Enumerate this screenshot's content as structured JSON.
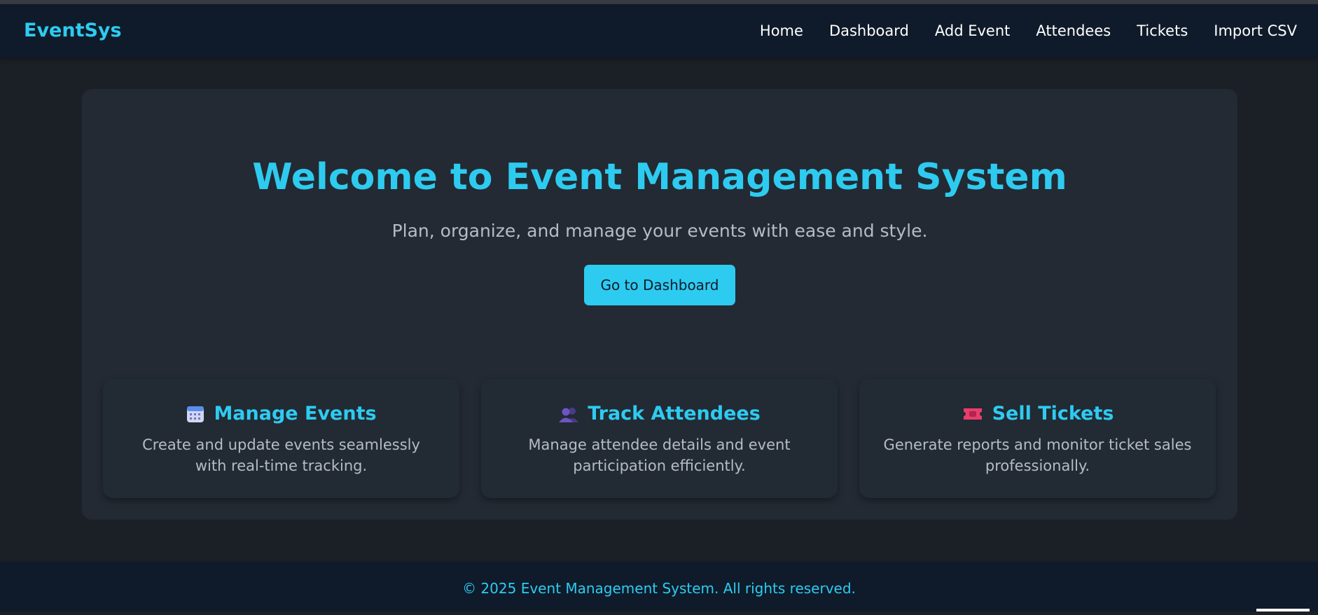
{
  "brand": "EventSys",
  "nav": {
    "items": [
      "Home",
      "Dashboard",
      "Add Event",
      "Attendees",
      "Tickets",
      "Import CSV"
    ]
  },
  "hero": {
    "title": "Welcome to Event Management System",
    "subtitle": "Plan, organize, and manage your events with ease and style.",
    "cta_label": "Go to Dashboard"
  },
  "features": [
    {
      "icon": "calendar-icon",
      "title": "Manage Events",
      "description": "Create and update events seamlessly with real-time tracking."
    },
    {
      "icon": "people-icon",
      "title": "Track Attendees",
      "description": "Manage attendee details and event participation efficiently."
    },
    {
      "icon": "ticket-icon",
      "title": "Sell Tickets",
      "description": "Generate reports and monitor ticket sales professionally."
    }
  ],
  "footer": {
    "text": "© 2025 Event Management System. All rights reserved."
  },
  "colors": {
    "accent": "#2ecbf0",
    "header_bg": "#0f1b2a",
    "page_bg": "#1b1f26",
    "card_bg": "#232a33"
  }
}
